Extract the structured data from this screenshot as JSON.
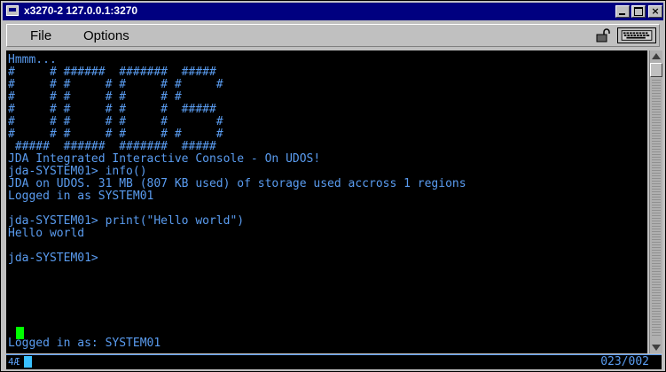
{
  "window": {
    "title": "x3270-2 127.0.0.1:3270"
  },
  "menu": {
    "items": [
      "File",
      "Options"
    ]
  },
  "icons": {
    "lock": "lock-icon",
    "keyboard": "keyboard-icon",
    "window": "terminal-window-icon"
  },
  "terminal": {
    "color": "#5a9cf0",
    "cursor_color": "#00ff00",
    "lines": [
      "Hmmm...",
      "#     # ######  #######  #####",
      "#     # #     # #     # #     #",
      "#     # #     # #     # #",
      "#     # #     # #     #  #####",
      "#     # #     # #     #       #",
      "#     # #     # #     # #     #",
      " #####  ######  #######  #####",
      "JDA Integrated Interactive Console - On UDOS!",
      "jda-SYSTEM01> info()",
      "JDA on UDOS. 31 MB (807 KB used) of storage used accross 1 regions",
      "Logged in as SYSTEM01",
      "",
      "jda-SYSTEM01> print(\"Hello world\")",
      "Hello world",
      "",
      "jda-SYSTEM01>"
    ],
    "status_line": "Logged in as: SYSTEM01"
  },
  "oia": {
    "indicator": "4Æ",
    "cursor_position": "023/002"
  }
}
